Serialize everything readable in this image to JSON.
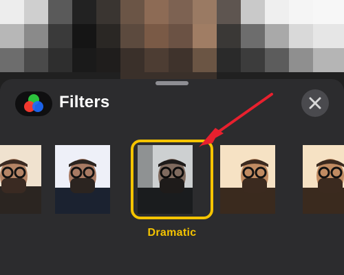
{
  "header": {
    "title": "Filters",
    "app_icon": "color-filters-icon",
    "close_icon": "close-icon"
  },
  "filters": [
    {
      "name": "",
      "style": "warm"
    },
    {
      "name": "",
      "style": "cool"
    },
    {
      "name": "Dramatic",
      "style": "dramatic",
      "selected": true
    },
    {
      "name": "",
      "style": "warm"
    },
    {
      "name": "",
      "style": "warm"
    }
  ],
  "selected_filter": {
    "label": "Dramatic"
  },
  "colors": {
    "selection": "#f5c400",
    "annotation_arrow": "#e8202e",
    "sheet": "#2c2c2e"
  }
}
